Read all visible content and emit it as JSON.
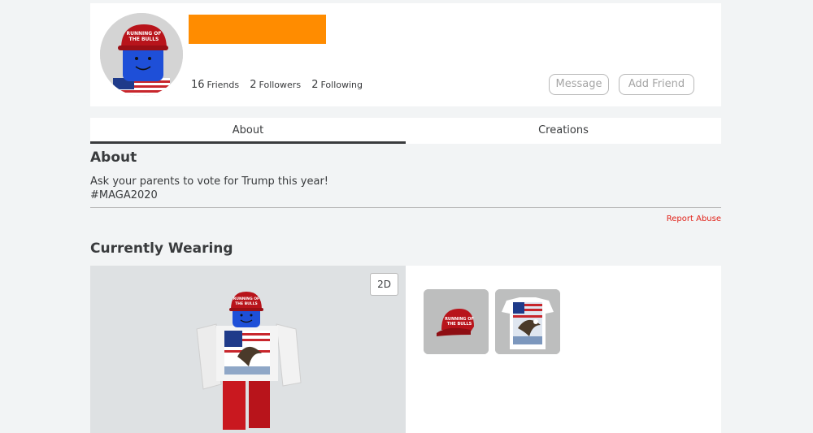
{
  "profile": {
    "stats": [
      {
        "count": "16",
        "label": "Friends"
      },
      {
        "count": "2",
        "label": "Followers"
      },
      {
        "count": "2",
        "label": "Following"
      }
    ],
    "buttons": {
      "message": "Message",
      "add_friend": "Add Friend"
    },
    "accent_color": "#ff8c00"
  },
  "tabs": [
    {
      "label": "About",
      "active": true
    },
    {
      "label": "Creations",
      "active": false
    }
  ],
  "about": {
    "heading": "About",
    "lines": [
      "Ask your parents to vote for Trump this year!",
      "#MAGA2020"
    ],
    "report_link": "Report Abuse"
  },
  "wearing": {
    "heading": "Currently Wearing",
    "view_toggle": "2D",
    "items": [
      {
        "icon": "red-cap-icon"
      },
      {
        "icon": "eagle-flag-shirt-icon"
      }
    ]
  },
  "icons": {
    "avatar": "avatar-headshot-icon",
    "hat_text": "RUNNING OF THE BULLS"
  }
}
